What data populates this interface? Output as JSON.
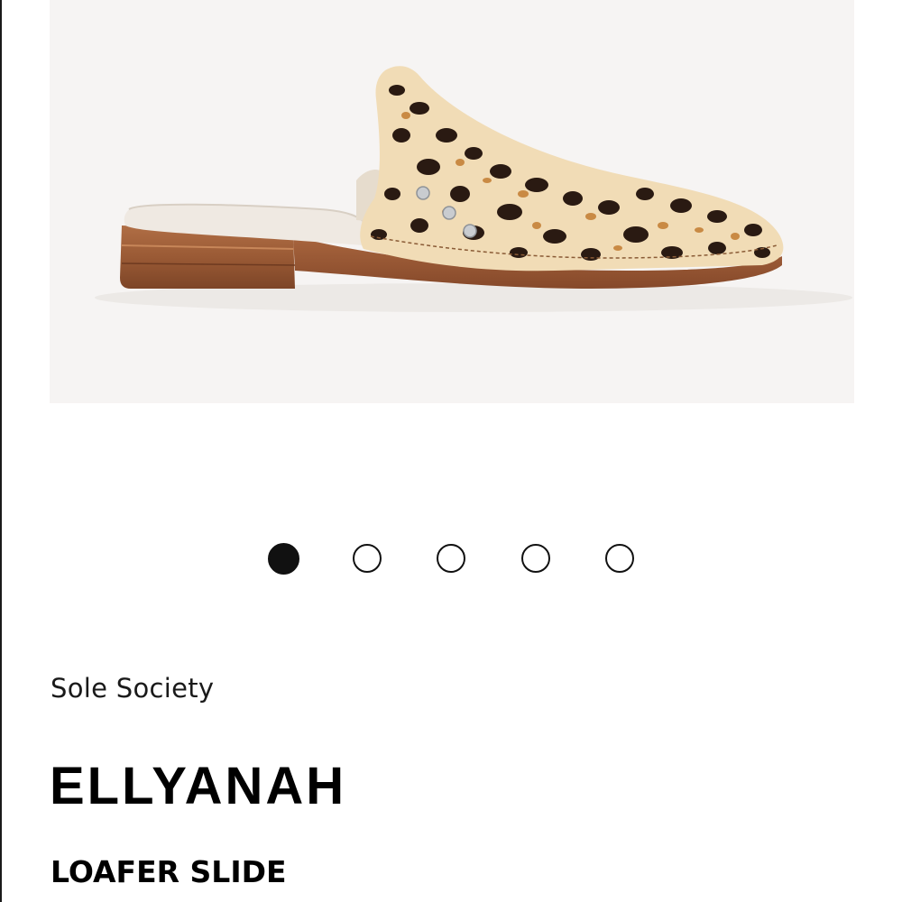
{
  "product": {
    "image_alt": "leopard print loafer slide",
    "brand": "Sole Society",
    "name": "ELLYANAH",
    "type": "LOAFER SLIDE"
  },
  "carousel": {
    "total_images": 5,
    "active_index": 0
  },
  "colors": {
    "background": "#ffffff",
    "image_backdrop": "#f6f4f3",
    "dot": "#111111",
    "text": "#000000"
  }
}
